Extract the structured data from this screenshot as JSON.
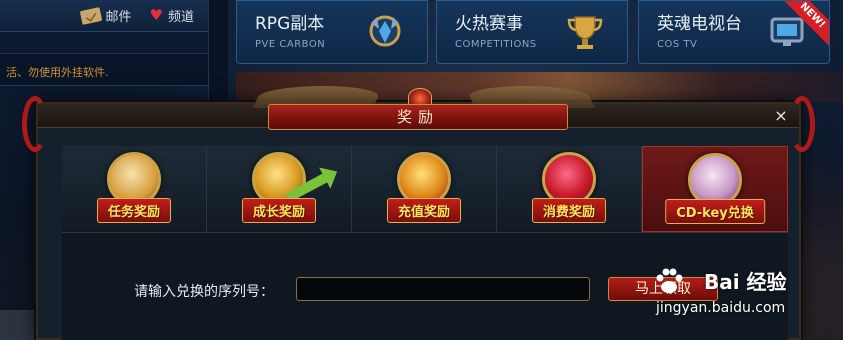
{
  "topbar": {
    "mail_label": "邮件",
    "channel_label": "频道",
    "notice_text": "活、勿使用外挂软件."
  },
  "tiles": [
    {
      "title": "RPG副本",
      "subtitle": "PVE CARBON",
      "icon": "emblem-icon"
    },
    {
      "title": "火热赛事",
      "subtitle": "COMPETITIONS",
      "icon": "trophy-icon"
    },
    {
      "title": "英魂电视台",
      "subtitle": "COS TV",
      "icon": "tv-icon",
      "badge": "NEW!"
    }
  ],
  "dialog": {
    "title": "奖励",
    "close_glyph": "×",
    "tabs": [
      {
        "label": "任务奖励",
        "icon": "gift-bag-icon",
        "active": false
      },
      {
        "label": "成长奖励",
        "icon": "treasure-chest-arrow-icon",
        "active": false
      },
      {
        "label": "充值奖励",
        "icon": "gold-coins-icon",
        "active": false
      },
      {
        "label": "消费奖励",
        "icon": "shopping-bags-icon",
        "active": false
      },
      {
        "label": "CD-key兑换",
        "icon": "gift-box-icon",
        "active": true
      }
    ],
    "input_label": "请输入兑换的序列号：",
    "input_value": "",
    "redeem_button": "马上领取"
  },
  "watermark": {
    "brand": "Bai 经验",
    "url": "jingyan.baidu.com"
  },
  "colors": {
    "accent_red": "#b01e18",
    "gold": "#e6b04a",
    "tab_label_text": "#ffe45a",
    "panel_blue": "#15355a"
  }
}
